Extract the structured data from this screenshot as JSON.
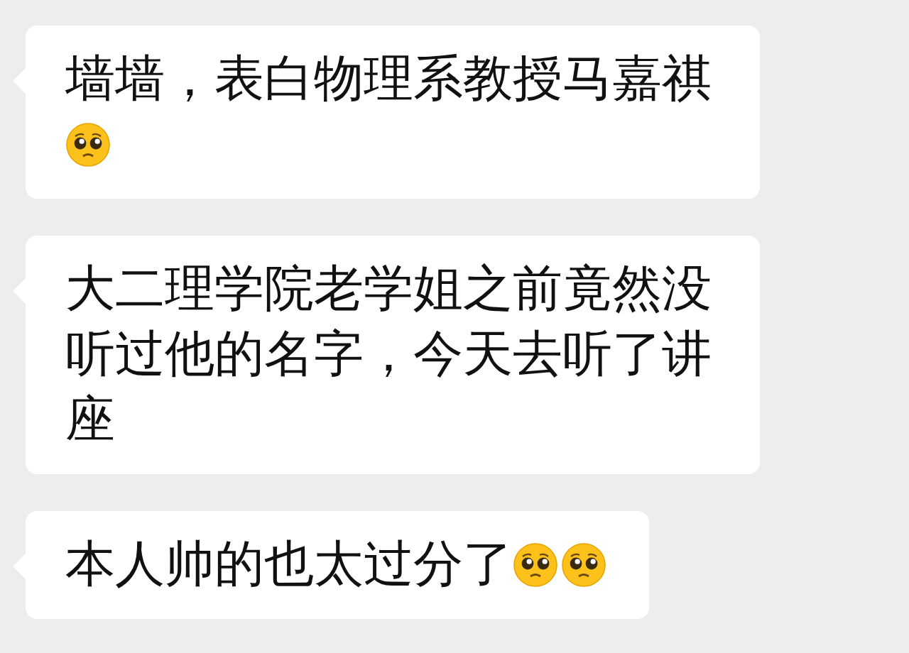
{
  "messages": [
    {
      "parts": [
        {
          "kind": "text",
          "text": "墙墙，表白物理系教授马嘉祺"
        },
        {
          "kind": "emoji"
        }
      ]
    },
    {
      "parts": [
        {
          "kind": "text",
          "text": "大二理学院老学姐之前竟然没听过他的名字，今天去听了讲座"
        }
      ]
    },
    {
      "parts": [
        {
          "kind": "text",
          "text": "本人帅的也太过分了"
        },
        {
          "kind": "emoji"
        },
        {
          "kind": "emoji"
        }
      ]
    }
  ]
}
